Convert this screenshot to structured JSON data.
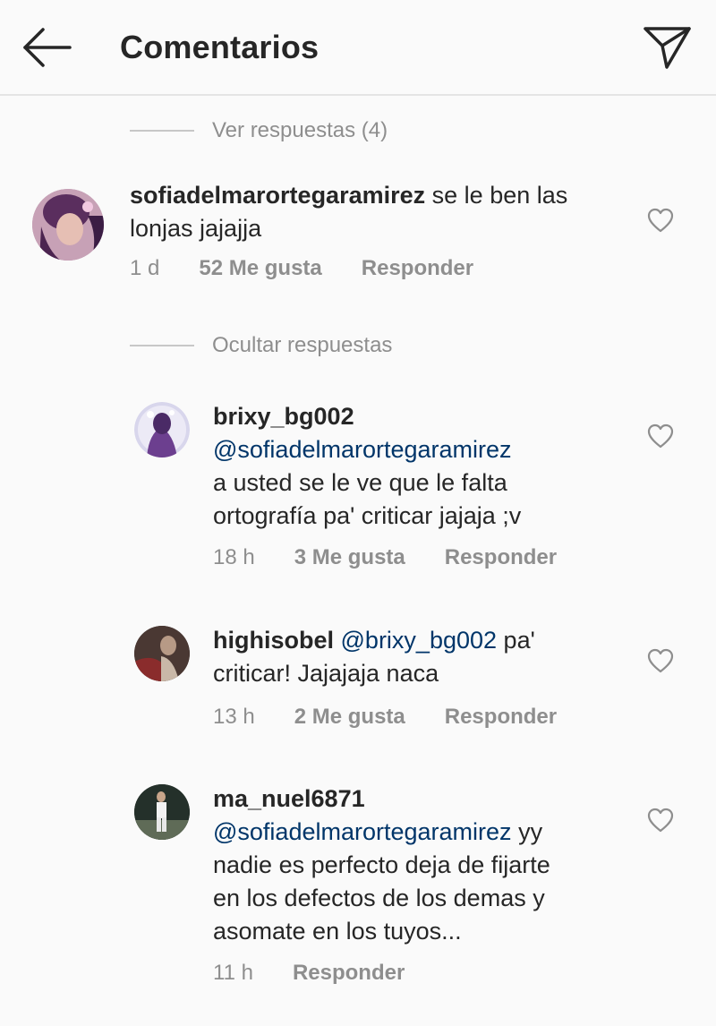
{
  "header": {
    "title": "Comentarios"
  },
  "toggles": {
    "view_replies": "Ver respuestas (4)",
    "hide_replies": "Ocultar respuestas"
  },
  "comments": [
    {
      "username": "sofiadelmarortegaramirez",
      "lines": [
        "se le ben las",
        "lonjas jajajja"
      ],
      "time": "1 d",
      "likes": "52 Me gusta",
      "reply": "Responder"
    },
    {
      "username": "brixy_bg002",
      "mention": "@sofiadelmarortegaramirez",
      "lines": [
        "a usted se le ve que le falta",
        "ortografía pa' criticar jajaja ;v"
      ],
      "time": "18 h",
      "likes": "3 Me gusta",
      "reply": "Responder"
    },
    {
      "username": "highisobel",
      "mention": "@brixy_bg002",
      "text_after_mention": "pa'",
      "lines": [
        "criticar! Jajajaja naca"
      ],
      "time": "13 h",
      "likes": "2 Me gusta",
      "reply": "Responder"
    },
    {
      "username": "ma_nuel6871",
      "mention": "@sofiadelmarortegaramirez",
      "text_after_mention": "yy",
      "lines": [
        "nadie es perfecto deja de fijarte",
        "en los defectos de los demas y",
        "asomate  en los tuyos..."
      ],
      "time": "11 h",
      "reply": "Responder"
    }
  ],
  "colors": {
    "text": "#262626",
    "secondary": "#8e8e8e",
    "mention": "#003569",
    "background": "#fafafa"
  },
  "icons": [
    "back-arrow-icon",
    "direct-send-icon",
    "heart-icon"
  ]
}
